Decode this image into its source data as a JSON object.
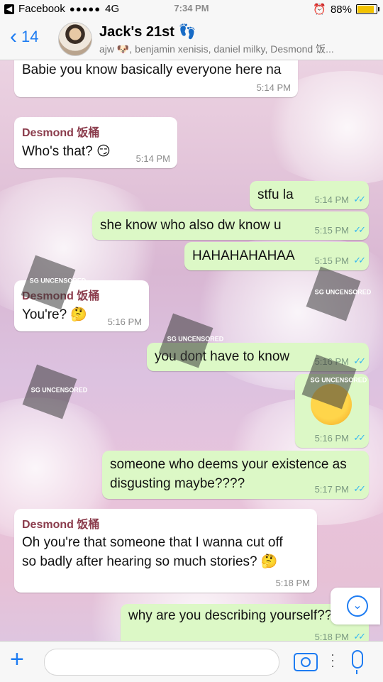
{
  "status": {
    "carrier": "Facebook",
    "signal": "●●●●●",
    "network": "4G",
    "time": "7:34 PM",
    "battery": "88%",
    "battery_level": 0.88,
    "back_app_glyph": "◀"
  },
  "header": {
    "back_label": "14",
    "back_icon": "chevron-left-icon",
    "title": "Jack's 21st 👣",
    "subtitle": "ajw 🐶, benjamin xenisis, daniel milky, Desmond 饭..."
  },
  "messages": [
    {
      "dir": "in",
      "sender": "",
      "text": "Babie you know basically everyone here na",
      "time": "5:14 PM"
    },
    {
      "dir": "in",
      "sender": "Desmond 饭桶",
      "text": "Who's that? 😏",
      "time": "5:14 PM"
    },
    {
      "dir": "out",
      "text": "stfu la",
      "time": "5:14 PM",
      "ticks": "✓✓"
    },
    {
      "dir": "out",
      "text": "she know who also dw know u",
      "time": "5:15 PM",
      "ticks": "✓✓"
    },
    {
      "dir": "out",
      "text": "HAHAHAHAHAA",
      "time": "5:15 PM",
      "ticks": "✓✓"
    },
    {
      "dir": "in",
      "sender": "Desmond 饭桶",
      "text": "You're? 🤔",
      "time": "5:16 PM"
    },
    {
      "dir": "out",
      "text": "you dont have to know",
      "time": "5:16 PM",
      "ticks": "✓✓"
    },
    {
      "dir": "out",
      "text": "🤔",
      "time": "5:16 PM",
      "ticks": "✓✓"
    },
    {
      "dir": "out",
      "text": "someone who deems your existence as\ndisgusting maybe????",
      "time": "5:17 PM",
      "ticks": "✓✓"
    },
    {
      "dir": "in",
      "sender": "Desmond 饭桶",
      "text": "Oh you're that someone that I wanna cut off\nso badly after hearing so much stories? 🤔",
      "time": "5:18 PM"
    },
    {
      "dir": "out",
      "text": "why are you describing yourself??",
      "time": "5:18 PM",
      "ticks": "✓✓"
    }
  ],
  "watermark": "SG UNCENSORED",
  "input": {
    "placeholder": "",
    "plus_icon": "plus-icon",
    "camera_icon": "camera-icon",
    "mic_icon": "microphone-icon"
  },
  "scroll_button": {
    "icon": "chevron-down-icon",
    "glyph": "⌄"
  }
}
